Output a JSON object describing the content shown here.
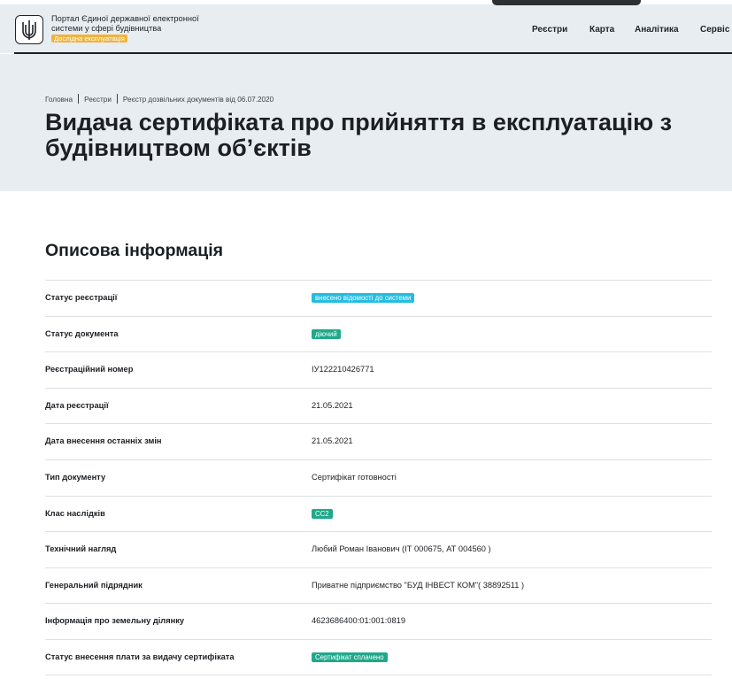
{
  "colors": {
    "header_bg": "#e8edf2",
    "beta_badge": "#f0b33b",
    "status_cyan": "#25bde0",
    "status_green": "#1ea98a"
  },
  "header": {
    "logo_icon": "trident-emblem-icon",
    "portal_title": "Портал Єдиної державної електронної системи у сфері будівництва",
    "beta_label": "Дослідна експлуатація",
    "nav": [
      "Реєстри",
      "Карта",
      "Аналітика",
      "Сервіс"
    ]
  },
  "breadcrumb": [
    "Головна",
    "Реєстри",
    "Реєстр дозвільних документів від 06.07.2020"
  ],
  "page_title_line1": "Видача сертифіката про прийняття в експлуатацію з",
  "page_title_line2": "будівництвом об’єктів",
  "section_title": "Описова інформація",
  "rows": [
    {
      "label": "Статус реєстрації",
      "value": "внесено відомості до системи"
    },
    {
      "label": "Статус документа",
      "value": "діючий"
    },
    {
      "label": "Реєстраційний номер",
      "value": "ІУ122210426771"
    },
    {
      "label": "Дата реєстрації",
      "value": "21.05.2021"
    },
    {
      "label": "Дата внесення останніх змін",
      "value": "21.05.2021"
    },
    {
      "label": "Тип документу",
      "value": "Сертифікат готовності"
    },
    {
      "label": "Клас наслідків",
      "value": "СС2"
    },
    {
      "label": "Технічний нагляд",
      "value": "Любий Роман Іванович (ІТ 000675, АТ 004560 )"
    },
    {
      "label": "Генеральний підрядник",
      "value": "Приватне підприємство \"БУД ІНВЕСТ КОМ\"( 38892511 )"
    },
    {
      "label": "Інформація про земельну ділянку",
      "value": "4623686400:01:001:0819"
    },
    {
      "label": "Статус внесення плати за видачу сертифіката",
      "value": "Сертифікат сплачено"
    }
  ]
}
